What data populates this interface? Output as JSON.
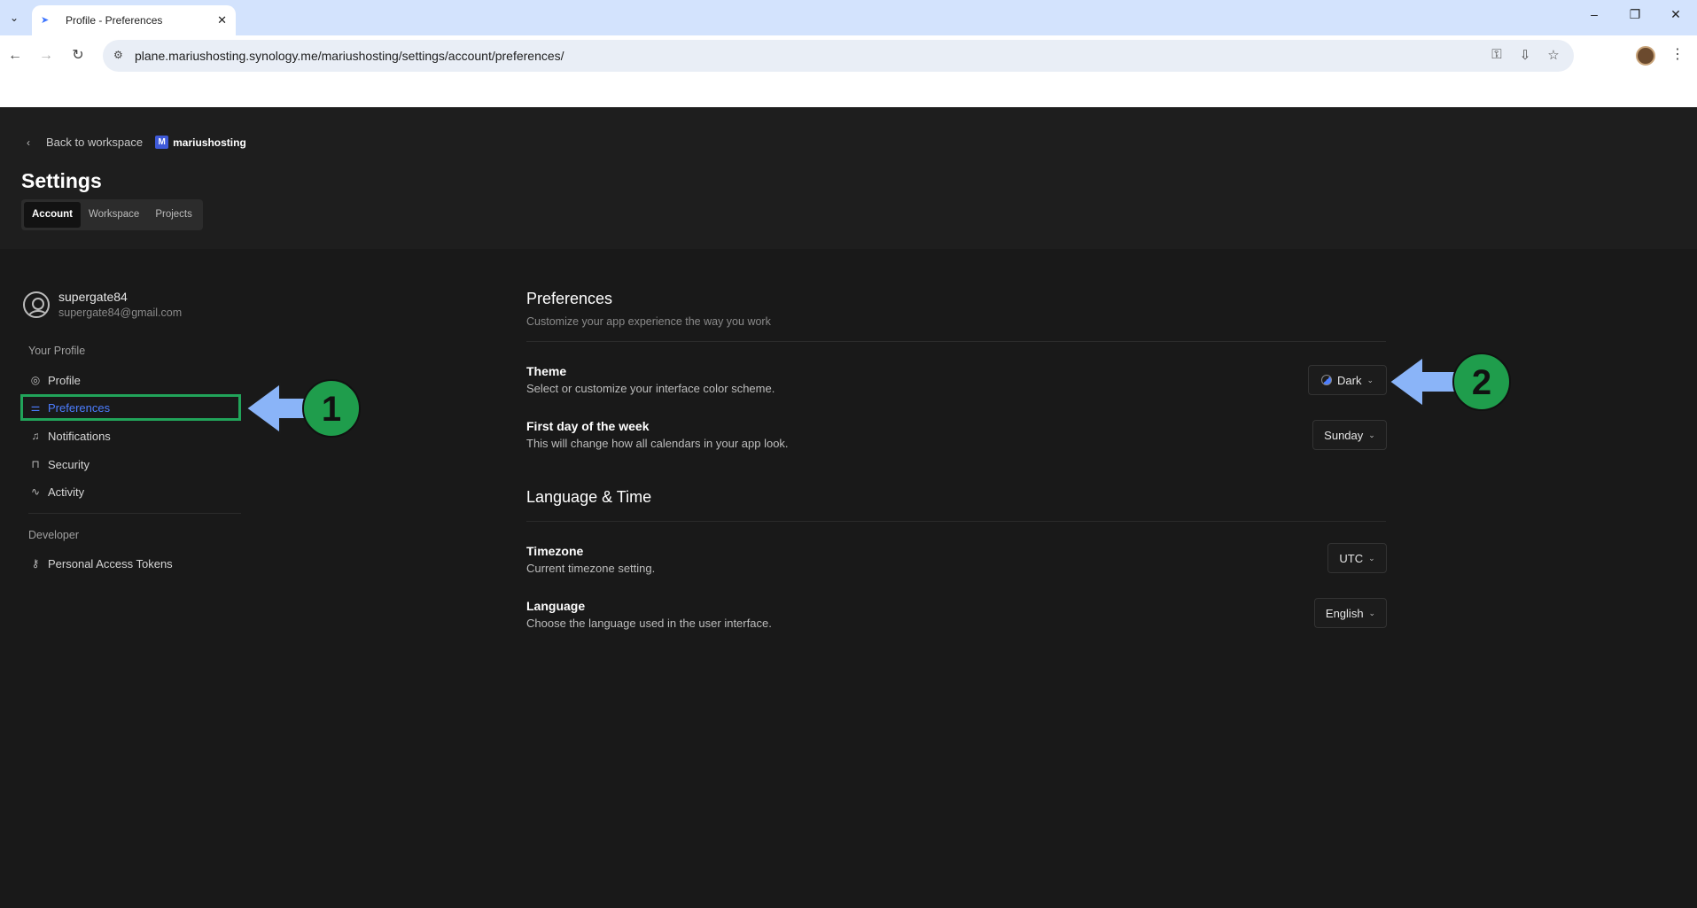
{
  "browser": {
    "tab_title": "Profile - Preferences",
    "url": "plane.mariushosting.synology.me/mariushosting/settings/account/preferences/"
  },
  "header": {
    "back_label": "Back to workspace",
    "workspace_badge": "M",
    "workspace_name": "mariushosting",
    "title": "Settings",
    "tabs": [
      {
        "label": "Account",
        "active": true
      },
      {
        "label": "Workspace",
        "active": false
      },
      {
        "label": "Projects",
        "active": false
      }
    ]
  },
  "sidebar": {
    "username": "supergate84",
    "email": "supergate84@gmail.com",
    "section_profile": "Your Profile",
    "items": [
      {
        "label": "Profile",
        "icon": "user-circle-icon"
      },
      {
        "label": "Preferences",
        "icon": "sliders-icon",
        "active": true
      },
      {
        "label": "Notifications",
        "icon": "bell-icon"
      },
      {
        "label": "Security",
        "icon": "lock-icon"
      },
      {
        "label": "Activity",
        "icon": "activity-icon"
      }
    ],
    "section_developer": "Developer",
    "dev_items": [
      {
        "label": "Personal Access Tokens",
        "icon": "key-icon"
      }
    ]
  },
  "main": {
    "preferences_title": "Preferences",
    "preferences_subtitle": "Customize your app experience the way you work",
    "theme": {
      "title": "Theme",
      "desc": "Select or customize your interface color scheme.",
      "value": "Dark"
    },
    "first_day": {
      "title": "First day of the week",
      "desc": "This will change how all calendars in your app look.",
      "value": "Sunday"
    },
    "lang_time_title": "Language & Time",
    "timezone": {
      "title": "Timezone",
      "desc": "Current timezone setting.",
      "value": "UTC"
    },
    "language": {
      "title": "Language",
      "desc": "Choose the language used in the user interface.",
      "value": "English"
    }
  },
  "annotations": {
    "arrow1": "1",
    "arrow2": "2"
  },
  "colors": {
    "accent": "#4c7dff",
    "highlight_box": "#21a45a",
    "annotation_arrow": "#8ab4f8",
    "annotation_circle": "#1f9d4c"
  }
}
